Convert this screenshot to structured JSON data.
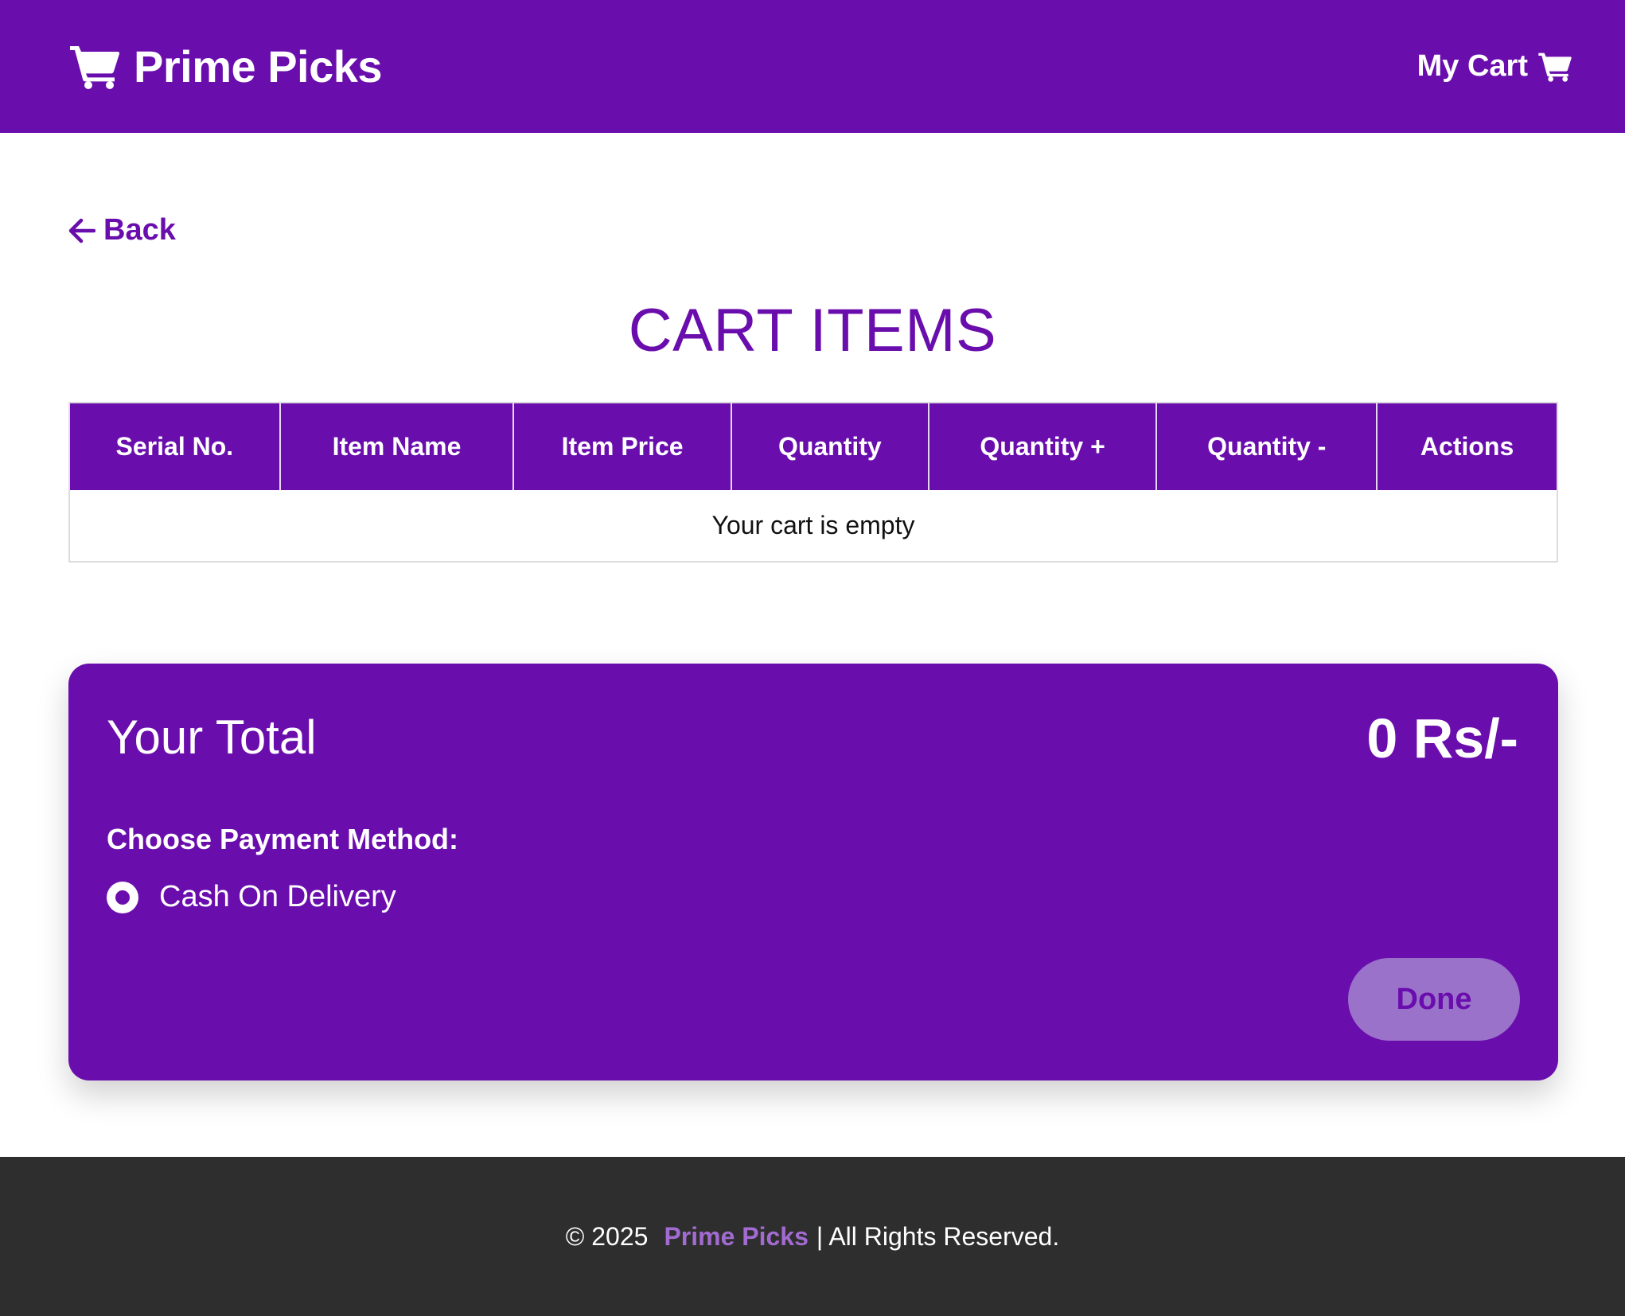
{
  "navbar": {
    "brand": "Prime Picks",
    "brand_icon": "shopping-cart-icon",
    "cart_label": "My Cart",
    "cart_icon": "shopping-cart-icon"
  },
  "back": {
    "label": "Back",
    "icon": "arrow-left-icon"
  },
  "page_title": "CART ITEMS",
  "table": {
    "columns": [
      "Serial No.",
      "Item Name",
      "Item Price",
      "Quantity",
      "Quantity +",
      "Quantity -",
      "Actions"
    ],
    "empty_message": "Your cart is empty"
  },
  "total": {
    "label": "Your Total",
    "value": "0 Rs/-",
    "payment_label": "Choose Payment Method:",
    "payment_option": "Cash On Delivery",
    "payment_selected": true,
    "done_label": "Done"
  },
  "footer": {
    "copyright": "© 2025",
    "brand": "Prime Picks",
    "rights": "| All Rights Reserved."
  },
  "colors": {
    "primary": "#6a0dad",
    "button_disabled": "#9b72c9",
    "footer_bg": "#2e2e2e",
    "footer_brand": "#a26bd1"
  }
}
